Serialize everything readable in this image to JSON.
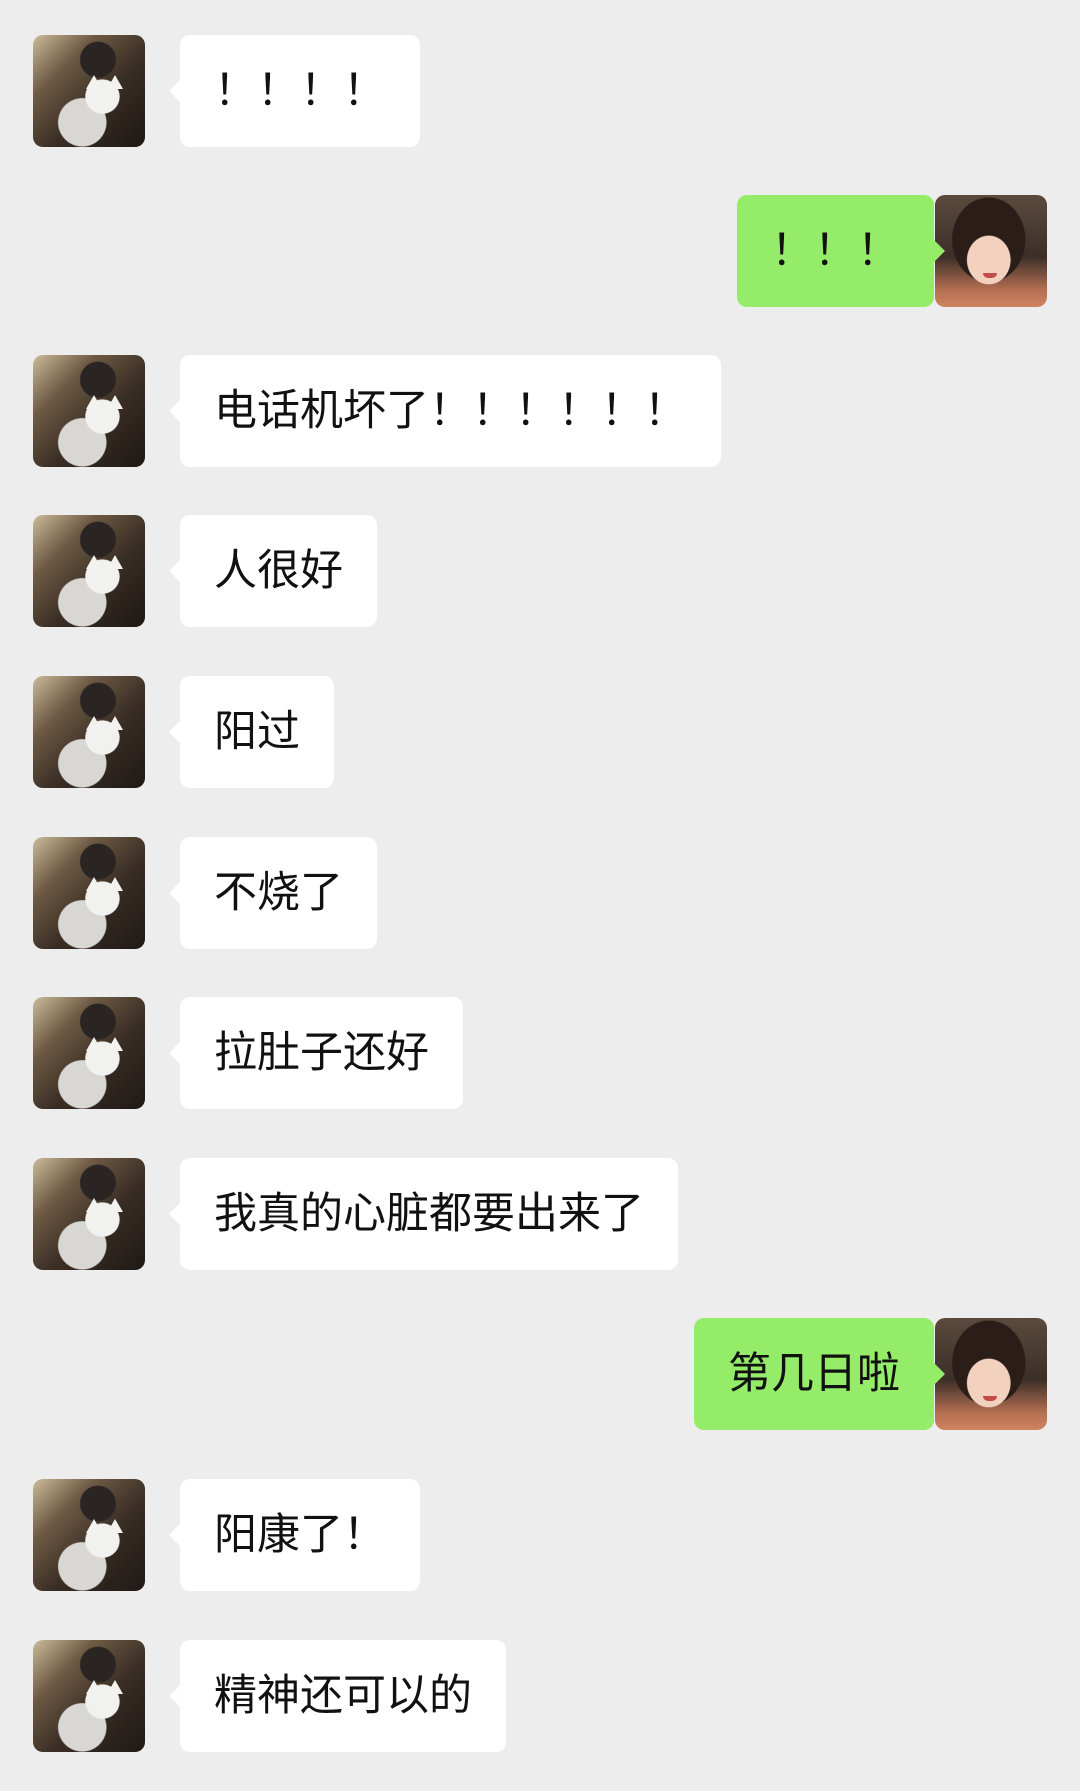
{
  "messages": [
    {
      "side": "in",
      "text": "！！！！"
    },
    {
      "side": "out",
      "text": "！！！"
    },
    {
      "side": "in",
      "text": "电话机坏了！！！！！！"
    },
    {
      "side": "in",
      "text": "人很好"
    },
    {
      "side": "in",
      "text": "阳过"
    },
    {
      "side": "in",
      "text": "不烧了"
    },
    {
      "side": "in",
      "text": "拉肚子还好"
    },
    {
      "side": "in",
      "text": "我真的心脏都要出来了"
    },
    {
      "side": "out",
      "text": "第几日啦"
    },
    {
      "side": "in",
      "text": "阳康了！"
    },
    {
      "side": "in",
      "text": "精神还可以的"
    }
  ],
  "colors": {
    "background": "#ededed",
    "incoming_bubble": "#ffffff",
    "outgoing_bubble": "#95ec69",
    "text": "#111111"
  }
}
